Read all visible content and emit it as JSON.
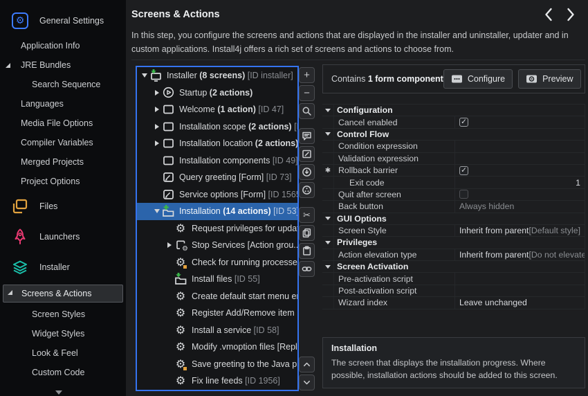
{
  "sidebar": {
    "items": [
      {
        "type": "top",
        "icon": "general-settings-icon",
        "label": "General Settings"
      },
      {
        "type": "item",
        "label": "Application Info"
      },
      {
        "type": "item",
        "expander": true,
        "label": "JRE Bundles"
      },
      {
        "type": "child",
        "label": "Search Sequence"
      },
      {
        "type": "item",
        "label": "Languages"
      },
      {
        "type": "item",
        "label": "Media File Options"
      },
      {
        "type": "item",
        "label": "Compiler Variables"
      },
      {
        "type": "item",
        "label": "Merged Projects"
      },
      {
        "type": "item",
        "label": "Project Options"
      },
      {
        "type": "top",
        "icon": "files-icon",
        "label": "Files"
      },
      {
        "type": "top",
        "icon": "launchers-icon",
        "label": "Launchers"
      },
      {
        "type": "top",
        "icon": "installer-icon",
        "label": "Installer"
      },
      {
        "type": "item",
        "expander": true,
        "selected": true,
        "label": "Screens & Actions"
      },
      {
        "type": "child",
        "label": "Screen Styles"
      },
      {
        "type": "child",
        "label": "Widget Styles"
      },
      {
        "type": "child",
        "label": "Look & Feel"
      },
      {
        "type": "child",
        "label": "Custom Code"
      }
    ]
  },
  "header": {
    "title": "Screens & Actions",
    "description": "In this step, you configure the screens and actions that are displayed in the installer and uninstaller, updater and in custom applications. Install4j offers a rich set of screens and actions to choose from."
  },
  "tree": {
    "items": [
      {
        "level": 0,
        "exp": "open",
        "icon": "installer-screen",
        "pre": "Installer ",
        "bold": "(8 screens) ",
        "gray": "[ID installer]"
      },
      {
        "level": 1,
        "exp": "closed",
        "icon": "startup",
        "pre": "Startup ",
        "bold": "(2 actions)"
      },
      {
        "level": 1,
        "exp": "closed",
        "icon": "screen",
        "pre": "Welcome ",
        "bold": "(1 action) ",
        "gray": "[ID 47]"
      },
      {
        "level": 1,
        "exp": "closed",
        "icon": "screen",
        "pre": "Installation scope ",
        "bold": "(2 actions) ",
        "gray": "[I..."
      },
      {
        "level": 1,
        "exp": "closed",
        "icon": "screen",
        "pre": "Installation location ",
        "bold": "(2 actions) ",
        "gray": "..."
      },
      {
        "level": 1,
        "icon": "screen",
        "pre": "Installation components ",
        "gray": "[ID 49]"
      },
      {
        "level": 1,
        "icon": "form",
        "pre": "Query greeting [Form] ",
        "gray": "[ID 73]"
      },
      {
        "level": 1,
        "icon": "form",
        "pre": "Service options [Form] ",
        "gray": "[ID 1565]"
      },
      {
        "level": 1,
        "exp": "open",
        "icon": "folder-plus",
        "selected": true,
        "pre": "Installation ",
        "bold": "(14 actions) ",
        "gray": "[ID 53]"
      },
      {
        "level": 2,
        "icon": "gear",
        "pre": "Request privileges for update.."
      },
      {
        "level": 2,
        "exp": "closed",
        "icon": "action-group",
        "pre": "Stop Services [Action grou..."
      },
      {
        "level": 2,
        "icon": "gear-badge",
        "pre": "Check for running processes ..."
      },
      {
        "level": 2,
        "icon": "folder-arrow",
        "pre": "Install files ",
        "gray": "[ID 55]"
      },
      {
        "level": 2,
        "icon": "gear",
        "pre": "Create default start menu en..."
      },
      {
        "level": 2,
        "icon": "gear",
        "pre": "Register Add/Remove item ",
        "gray": "[I..."
      },
      {
        "level": 2,
        "icon": "gear",
        "pre": "Install a service ",
        "gray": "[ID 58]"
      },
      {
        "level": 2,
        "icon": "gear",
        "pre": "Modify .vmoption files [Repla..."
      },
      {
        "level": 2,
        "icon": "gear-badge",
        "pre": "Save greeting to the Java pre..."
      },
      {
        "level": 2,
        "icon": "gear",
        "pre": "Fix line feeds ",
        "gray": "[ID 1956]"
      }
    ]
  },
  "toolbar": {
    "buttons": [
      "plus",
      "minus",
      "search",
      "comment",
      "note",
      "circle-down",
      "circle-dots",
      "cut",
      "copy",
      "paste",
      "link"
    ],
    "movers": [
      "move-up",
      "move-down"
    ]
  },
  "panel": {
    "summary_prefix": "Contains ",
    "summary_bold": "1 form component",
    "configure_label": "Configure",
    "preview_label": "Preview",
    "properties": [
      {
        "type": "section",
        "label": "Configuration"
      },
      {
        "type": "row",
        "label": "Cancel enabled",
        "value": {
          "kind": "checkbox",
          "checked": true
        }
      },
      {
        "type": "section",
        "label": "Control Flow"
      },
      {
        "type": "row",
        "label": "Condition expression",
        "value": {
          "kind": "empty"
        }
      },
      {
        "type": "row",
        "label": "Validation expression",
        "value": {
          "kind": "empty"
        }
      },
      {
        "type": "row",
        "label": "Rollback barrier",
        "marker": "✱",
        "value": {
          "kind": "checkbox",
          "checked": true
        }
      },
      {
        "type": "row",
        "label": "Exit code",
        "indent": true,
        "value": {
          "kind": "text-right",
          "text": "1"
        }
      },
      {
        "type": "row",
        "label": "Quit after screen",
        "value": {
          "kind": "checkbox",
          "checked": false
        }
      },
      {
        "type": "row",
        "label": "Back button",
        "value": {
          "kind": "muted",
          "text": "Always hidden"
        }
      },
      {
        "type": "section",
        "label": "GUI Options"
      },
      {
        "type": "row",
        "label": "Screen Style",
        "value": {
          "kind": "inherit",
          "text": "Inherit from parent ",
          "extra": "[Default style]"
        }
      },
      {
        "type": "section",
        "label": "Privileges"
      },
      {
        "type": "row",
        "label": "Action elevation type",
        "value": {
          "kind": "inherit",
          "text": "Inherit from parent ",
          "extra": "[Do not elevate]"
        }
      },
      {
        "type": "section",
        "label": "Screen Activation"
      },
      {
        "type": "row",
        "label": "Pre-activation script",
        "value": {
          "kind": "empty"
        }
      },
      {
        "type": "row",
        "label": "Post-activation script",
        "value": {
          "kind": "empty"
        }
      },
      {
        "type": "row",
        "label": "Wizard index",
        "value": {
          "kind": "plain",
          "text": "Leave unchanged"
        }
      }
    ],
    "description": {
      "title": "Installation",
      "body": "The screen that displays the installation progress. Where possible, installation actions should be added to this screen."
    }
  }
}
